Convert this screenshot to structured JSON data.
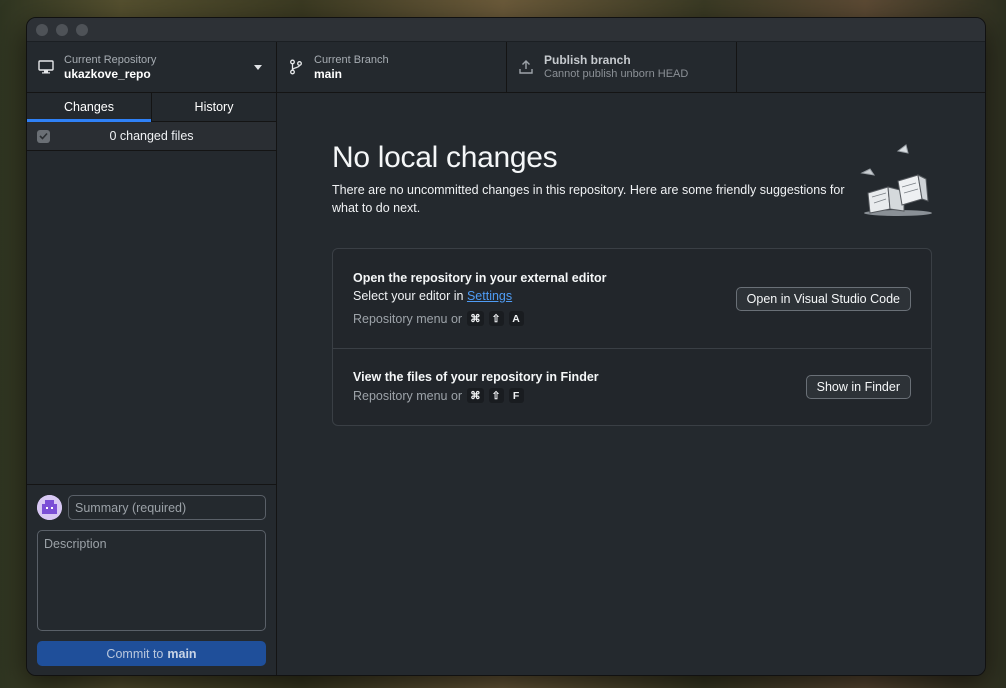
{
  "toolbar": {
    "repository": {
      "label": "Current Repository",
      "value": "ukazkove_repo"
    },
    "branch": {
      "label": "Current Branch",
      "value": "main"
    },
    "publish": {
      "title": "Publish branch",
      "subtitle": "Cannot publish unborn HEAD"
    }
  },
  "sidebar": {
    "tabs": [
      {
        "label": "Changes",
        "active": true
      },
      {
        "label": "History",
        "active": false
      }
    ],
    "changed_files": "0 changed files",
    "commit": {
      "summary_placeholder": "Summary (required)",
      "description_placeholder": "Description",
      "button_prefix": "Commit to",
      "button_branch": "main"
    }
  },
  "main": {
    "heading": "No local changes",
    "intro": "There are no uncommitted changes in this repository. Here are some friendly suggestions for what to do next.",
    "editor_card": {
      "title": "Open the repository in your external editor",
      "line_prefix": "Select your editor in",
      "settings_link": "Settings",
      "shortcut_prefix": "Repository menu or",
      "keys": [
        "⌘",
        "⇧",
        "A"
      ],
      "button": "Open in Visual Studio Code"
    },
    "finder_card": {
      "title": "View the files of your repository in Finder",
      "shortcut_prefix": "Repository menu or",
      "keys": [
        "⌘",
        "⇧",
        "F"
      ],
      "button": "Show in Finder"
    }
  },
  "colors": {
    "accent": "#2f81f7",
    "link": "#4f9cf5",
    "commit_button": "#1f4f9a",
    "window_bg": "#24292e"
  },
  "icons": {
    "repository": "computer-icon",
    "branch": "git-branch-icon",
    "publish": "upload-icon"
  }
}
